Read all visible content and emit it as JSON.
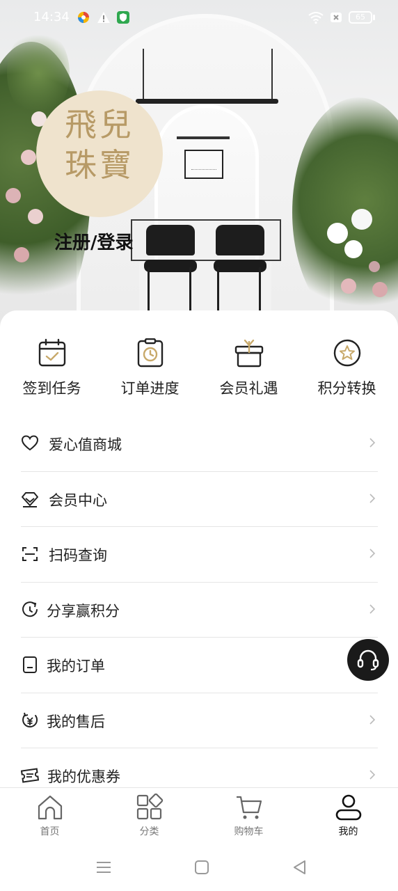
{
  "status_bar": {
    "time": "14:34",
    "battery": "65",
    "icons": [
      "app-icon",
      "warning-icon",
      "shield-app-icon",
      "wifi-icon",
      "sim-icon",
      "battery-icon"
    ]
  },
  "hero": {
    "logo_line1": "飛兒",
    "logo_line2": "珠寶",
    "login_label": "注册/登录"
  },
  "quick_actions": [
    {
      "label": "签到任务",
      "icon": "calendar-check-icon"
    },
    {
      "label": "订单进度",
      "icon": "clock-clipboard-icon"
    },
    {
      "label": "会员礼遇",
      "icon": "gift-box-icon"
    },
    {
      "label": "积分转换",
      "icon": "star-circle-icon"
    }
  ],
  "menu": [
    {
      "label": "爱心值商城",
      "icon": "heart-icon"
    },
    {
      "label": "会员中心",
      "icon": "diamond-icon"
    },
    {
      "label": "扫码查询",
      "icon": "scan-icon"
    },
    {
      "label": "分享赢积分",
      "icon": "refresh-share-icon"
    },
    {
      "label": "我的订单",
      "icon": "document-icon"
    },
    {
      "label": "我的售后",
      "icon": "yen-service-icon"
    },
    {
      "label": "我的优惠券",
      "icon": "coupon-icon"
    }
  ],
  "bottom_nav": [
    {
      "label": "首页",
      "icon": "home-icon",
      "active": false
    },
    {
      "label": "分类",
      "icon": "category-grid-icon",
      "active": false
    },
    {
      "label": "购物车",
      "icon": "cart-icon",
      "active": false
    },
    {
      "label": "我的",
      "icon": "user-icon",
      "active": true
    }
  ],
  "colors": {
    "logo_bg": "#efe3cd",
    "logo_text": "#b79a66",
    "support_button": "#1a1a1a",
    "active_nav": "#111111",
    "inactive_nav": "#777777"
  }
}
